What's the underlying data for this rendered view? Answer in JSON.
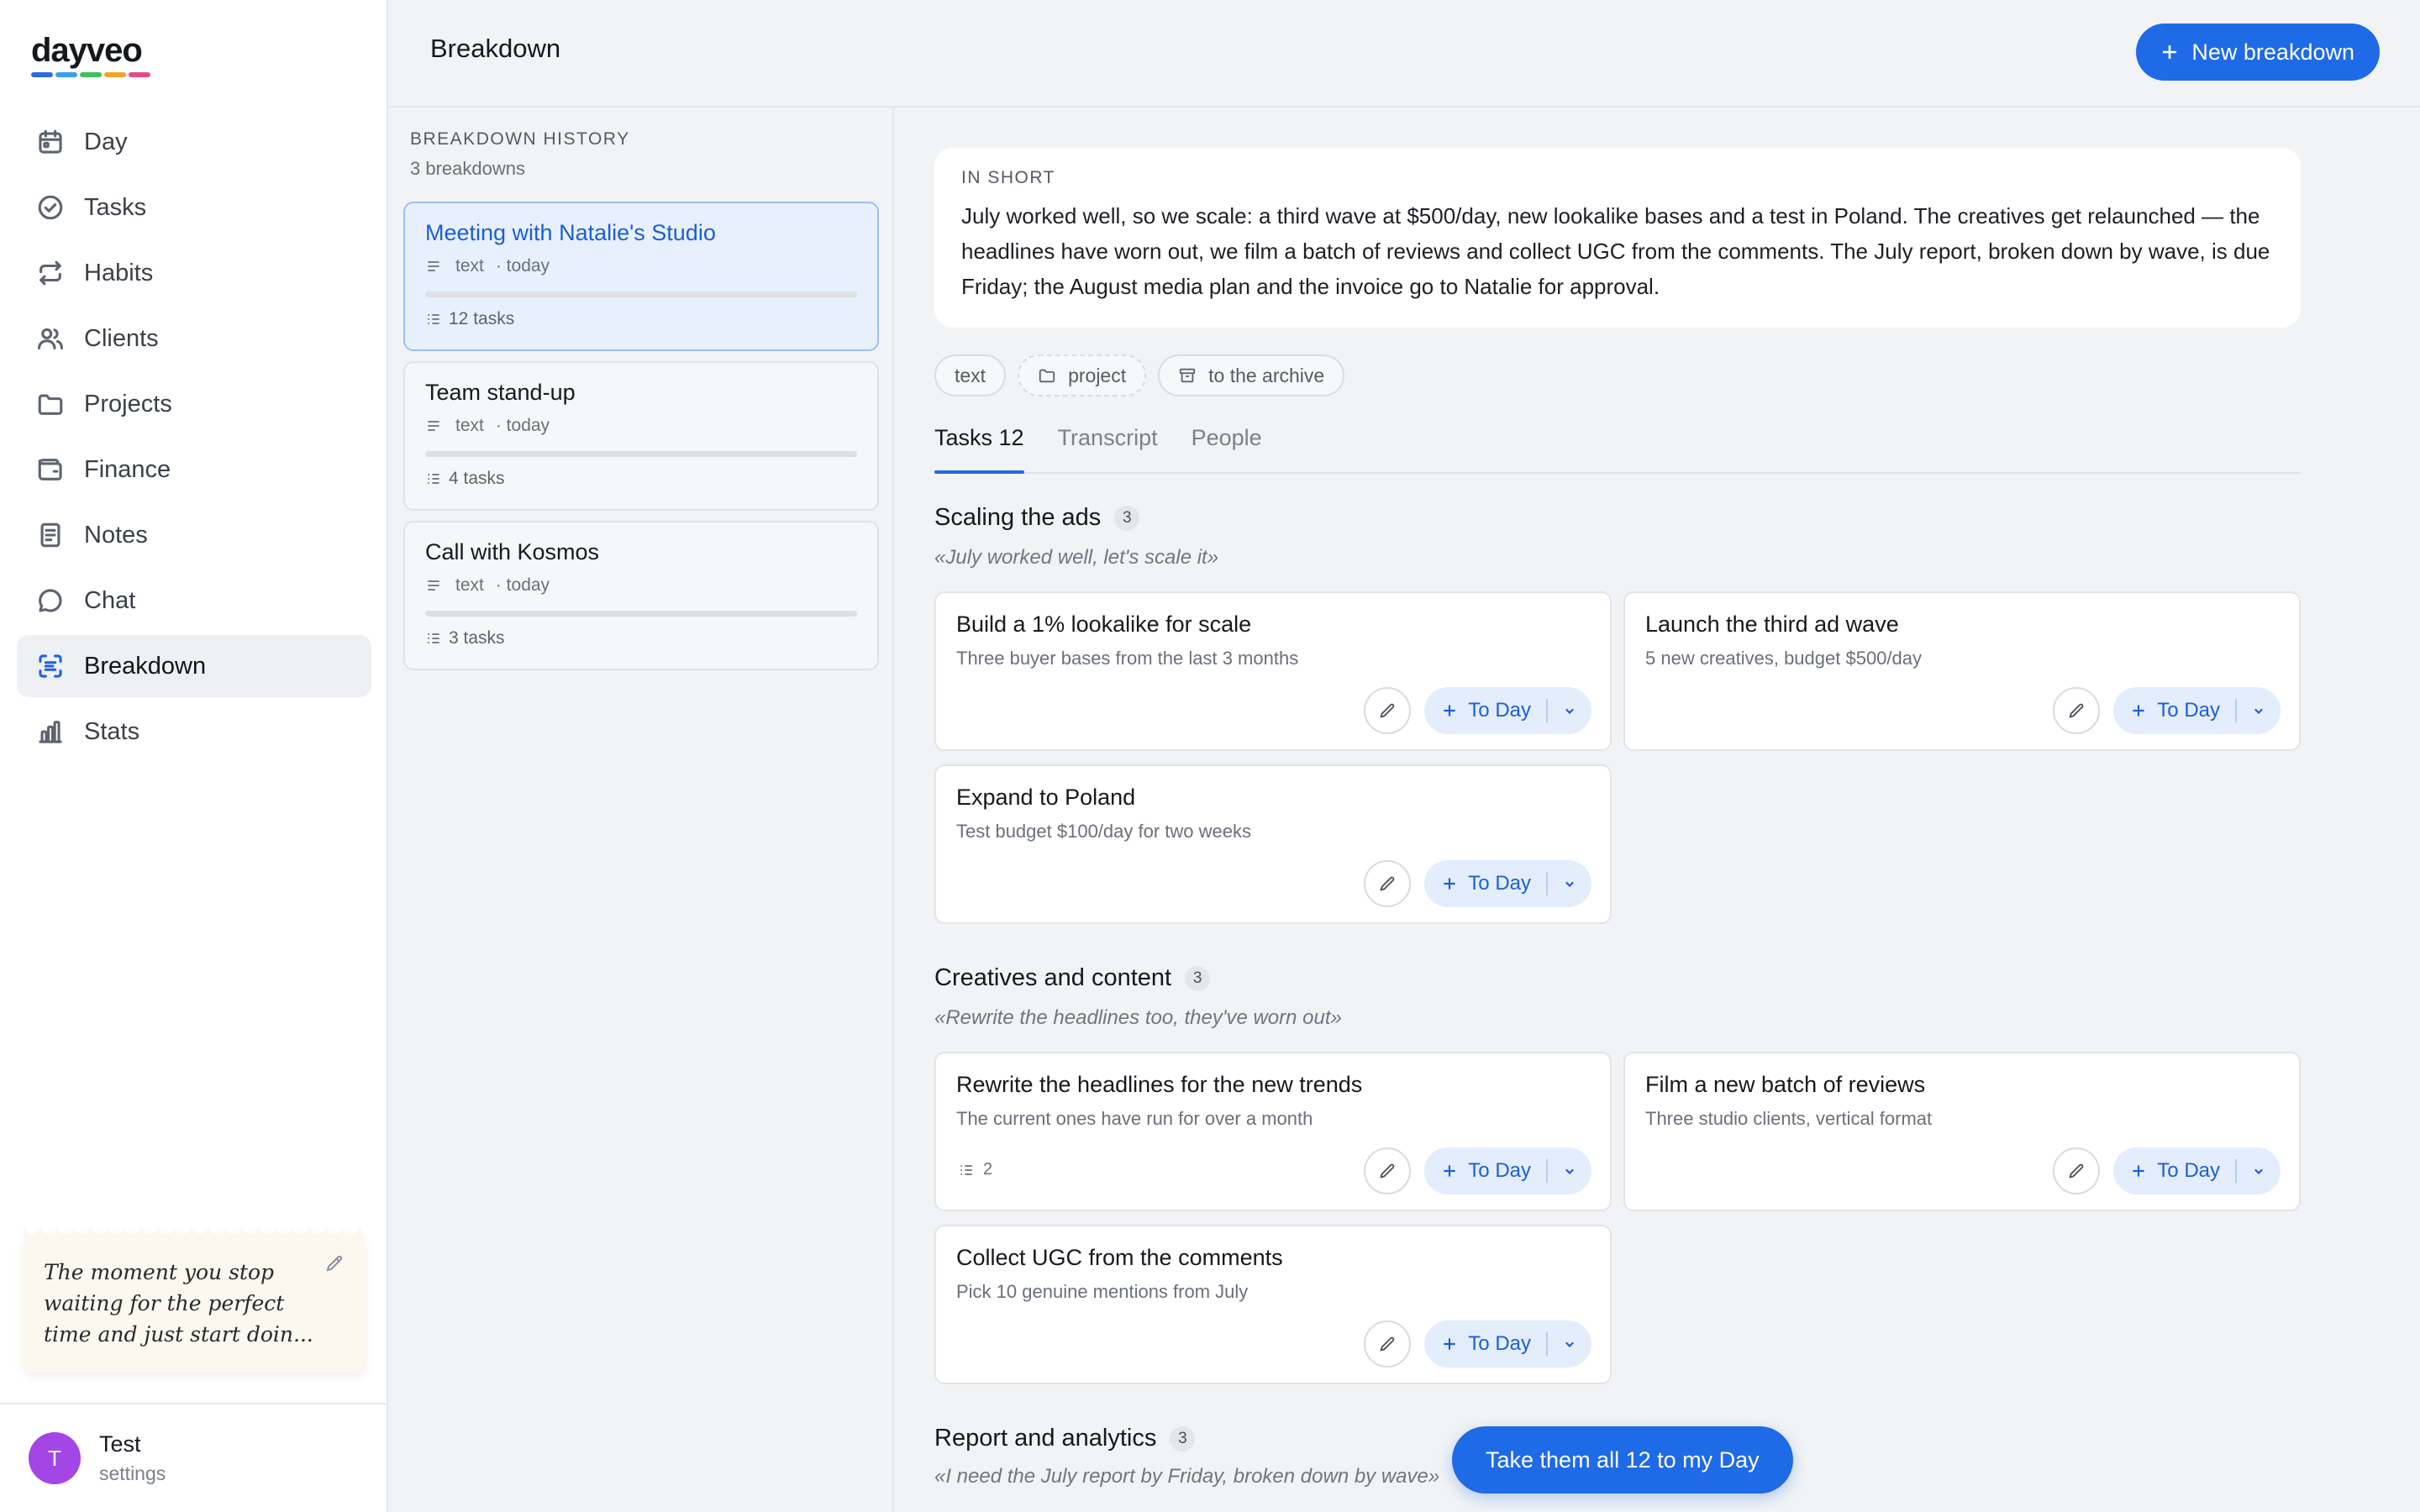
{
  "app": {
    "name": "dayveo",
    "logo_colors": [
      "#2d6ae3",
      "#3a9ff0",
      "#3fbf5a",
      "#f0a527",
      "#e24a8d"
    ]
  },
  "sidebar": {
    "items": [
      {
        "label": "Day",
        "icon": "calendar-icon"
      },
      {
        "label": "Tasks",
        "icon": "check-circle-icon"
      },
      {
        "label": "Habits",
        "icon": "repeat-icon"
      },
      {
        "label": "Clients",
        "icon": "users-icon"
      },
      {
        "label": "Projects",
        "icon": "folder-icon"
      },
      {
        "label": "Finance",
        "icon": "wallet-icon"
      },
      {
        "label": "Notes",
        "icon": "note-icon"
      },
      {
        "label": "Chat",
        "icon": "chat-icon"
      },
      {
        "label": "Breakdown",
        "icon": "scan-icon",
        "active": true
      },
      {
        "label": "Stats",
        "icon": "bar-chart-icon"
      }
    ],
    "quote": "The moment you stop waiting for the perfect time and just start doin...",
    "user": {
      "initial": "T",
      "name": "Test",
      "sub": "settings",
      "avatar_color": "#a445e6"
    }
  },
  "header": {
    "title": "Breakdown",
    "new_button": "New breakdown"
  },
  "history": {
    "title": "BREAKDOWN HISTORY",
    "count": "3 breakdowns",
    "items": [
      {
        "name": "Meeting with Natalie's Studio",
        "type": "text",
        "date": "· today",
        "tasks": "12 tasks",
        "active": true
      },
      {
        "name": "Team stand-up",
        "type": "text",
        "date": "· today",
        "tasks": "4 tasks"
      },
      {
        "name": "Call with Kosmos",
        "type": "text",
        "date": "· today",
        "tasks": "3 tasks"
      }
    ]
  },
  "summary": {
    "title": "IN SHORT",
    "text": "July worked well, so we scale: a third wave at $500/day, new lookalike bases and a test in Poland. The creatives get relaunched — the headlines have worn out, we film a batch of reviews and collect UGC from the comments. The July report, broken down by wave, is due Friday; the August media plan and the invoice go to Natalie for approval."
  },
  "chips": {
    "text": "text",
    "project": "project",
    "archive": "to the archive"
  },
  "tabs": [
    "Tasks 12",
    "Transcript",
    "People"
  ],
  "task_button": "To Day",
  "groups": [
    {
      "title": "Scaling the ads",
      "count": "3",
      "quote": "«July worked well, let's scale it»",
      "tasks": [
        {
          "title": "Build a 1% lookalike for scale",
          "desc": "Three buyer bases from the last 3 months"
        },
        {
          "title": "Launch the third ad wave",
          "desc": "5 new creatives, budget $500/day"
        },
        {
          "title": "Expand to Poland",
          "desc": "Test budget $100/day for two weeks"
        }
      ]
    },
    {
      "title": "Creatives and content",
      "count": "3",
      "quote": "«Rewrite the headlines too, they've worn out»",
      "tasks": [
        {
          "title": "Rewrite the headlines for the new trends",
          "desc": "The current ones have run for over a month",
          "subtasks": "2"
        },
        {
          "title": "Film a new batch of reviews",
          "desc": "Three studio clients, vertical format"
        },
        {
          "title": "Collect UGC from the comments",
          "desc": "Pick 10 genuine mentions from July"
        }
      ]
    },
    {
      "title": "Report and analytics",
      "count": "3",
      "quote": "«I need the July report by Friday, broken down by wave»"
    }
  ],
  "take_all_button": "Take them all 12 to my Day"
}
